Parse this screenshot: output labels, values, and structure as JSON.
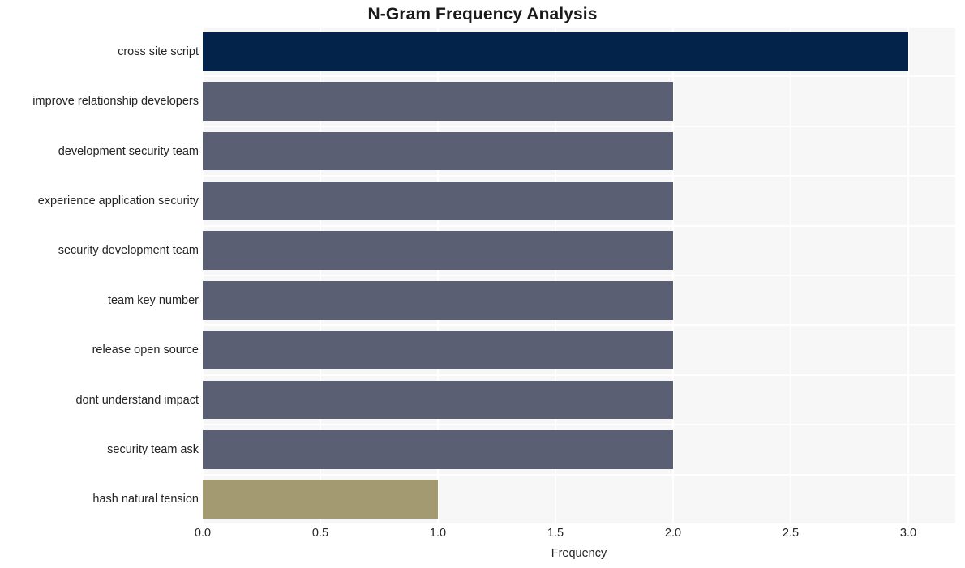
{
  "chart_data": {
    "type": "bar",
    "orientation": "horizontal",
    "title": "N-Gram Frequency Analysis",
    "xlabel": "Frequency",
    "ylabel": "",
    "xlim": [
      0.0,
      3.2
    ],
    "xticks": [
      "0.0",
      "0.5",
      "1.0",
      "1.5",
      "2.0",
      "2.5",
      "3.0"
    ],
    "xtick_values": [
      0.0,
      0.5,
      1.0,
      1.5,
      2.0,
      2.5,
      3.0
    ],
    "grid": true,
    "legend": "none",
    "categories": [
      "cross site script",
      "improve relationship developers",
      "development security team",
      "experience application security",
      "security development team",
      "team key number",
      "release open source",
      "dont understand impact",
      "security team ask",
      "hash natural tension"
    ],
    "values": [
      3,
      2,
      2,
      2,
      2,
      2,
      2,
      2,
      2,
      1
    ],
    "bar_colors": [
      "#03234b",
      "#5a5f73",
      "#5a5f73",
      "#5a5f73",
      "#5a5f73",
      "#5a5f73",
      "#5a5f73",
      "#5a5f73",
      "#5a5f73",
      "#a49a72"
    ]
  },
  "style": {
    "plot_background": "#f7f7f8",
    "grid_color": "#ffffff",
    "figure_background": "#ffffff",
    "text_color": "#242424",
    "title_color": "#1a1a1a"
  }
}
